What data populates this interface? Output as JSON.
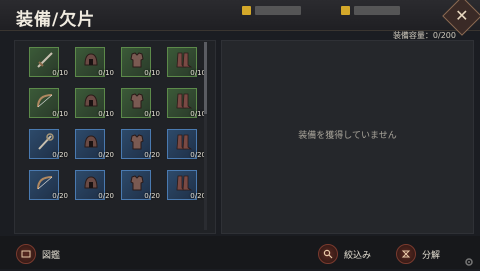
{
  "header": {
    "title": "装備/欠片",
    "close_glyph": "✕"
  },
  "capacity": "装備容量：0/200",
  "inventory": {
    "items": [
      {
        "icon": "sword-icon",
        "rarity": "green",
        "count": "0/10"
      },
      {
        "icon": "helmet-icon",
        "rarity": "green",
        "count": "0/10"
      },
      {
        "icon": "armor-icon",
        "rarity": "green",
        "count": "0/10"
      },
      {
        "icon": "boots-icon",
        "rarity": "green",
        "count": "0/10"
      },
      {
        "icon": "bow-icon",
        "rarity": "green",
        "count": "0/10"
      },
      {
        "icon": "helmet-icon",
        "rarity": "green",
        "count": "0/10"
      },
      {
        "icon": "armor-icon",
        "rarity": "green",
        "count": "0/10"
      },
      {
        "icon": "boots-icon",
        "rarity": "green",
        "count": "0/10"
      },
      {
        "icon": "weapon-icon",
        "rarity": "blue",
        "count": "0/20"
      },
      {
        "icon": "helmet-icon",
        "rarity": "blue",
        "count": "0/20"
      },
      {
        "icon": "armor-icon",
        "rarity": "blue",
        "count": "0/20"
      },
      {
        "icon": "boots-icon",
        "rarity": "blue",
        "count": "0/20"
      },
      {
        "icon": "bow-icon",
        "rarity": "blue",
        "count": "0/20"
      },
      {
        "icon": "helmet-icon",
        "rarity": "blue",
        "count": "0/20"
      },
      {
        "icon": "armor-icon",
        "rarity": "blue",
        "count": "0/20"
      },
      {
        "icon": "boots-icon",
        "rarity": "blue",
        "count": "0/20"
      }
    ]
  },
  "detail": {
    "empty_message": "装備を獲得していません"
  },
  "bottom": {
    "catalog_label": "図鑑",
    "filter_label": "絞込み",
    "decompose_label": "分解"
  },
  "colors": {
    "accent": "#d4a82a",
    "green_rarity": "#5c8a4a",
    "blue_rarity": "#4a7ab0"
  }
}
